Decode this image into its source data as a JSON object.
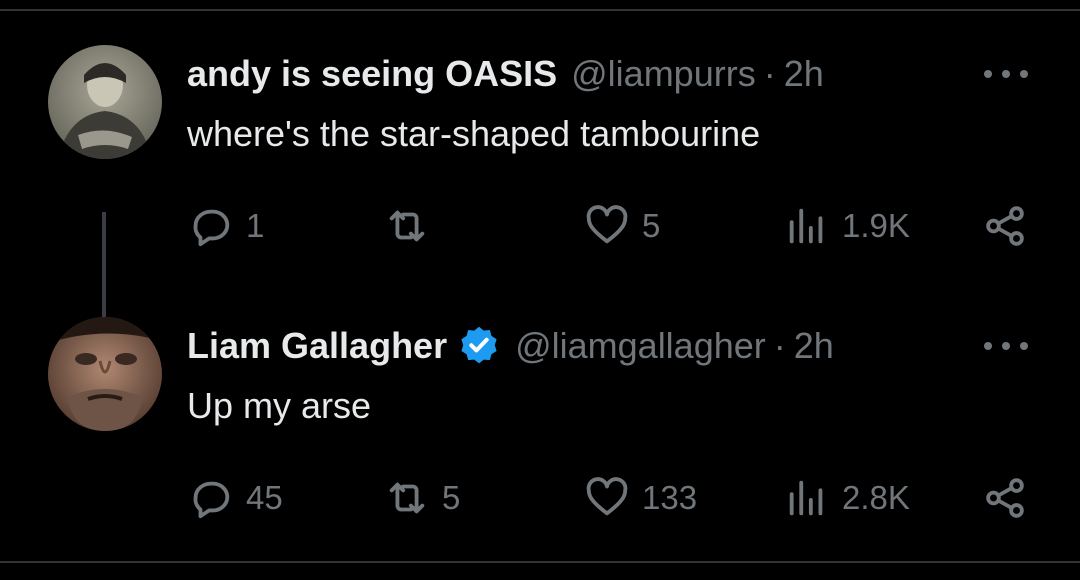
{
  "tweets": [
    {
      "name": "andy is seeing OASIS",
      "handle": "@liampurrs",
      "dot": "·",
      "time": "2h",
      "verified": false,
      "text": "where's the star-shaped tambourine",
      "reply_count": "1",
      "retweet_count": "",
      "like_count": "5",
      "view_count": "1.9K"
    },
    {
      "name": "Liam Gallagher",
      "handle": "@liamgallagher",
      "dot": "·",
      "time": "2h",
      "verified": true,
      "text": "Up my arse",
      "reply_count": "45",
      "retweet_count": "5",
      "like_count": "133",
      "view_count": "2.8K"
    }
  ],
  "colors": {
    "background": "#000000",
    "text_primary": "#e7e9ea",
    "text_secondary": "#71767b",
    "verified_blue": "#1d9bf0",
    "divider": "#2f3336"
  },
  "icons": [
    "reply-icon",
    "retweet-icon",
    "like-icon",
    "views-icon",
    "share-icon",
    "more-icon",
    "verified-badge-icon"
  ]
}
